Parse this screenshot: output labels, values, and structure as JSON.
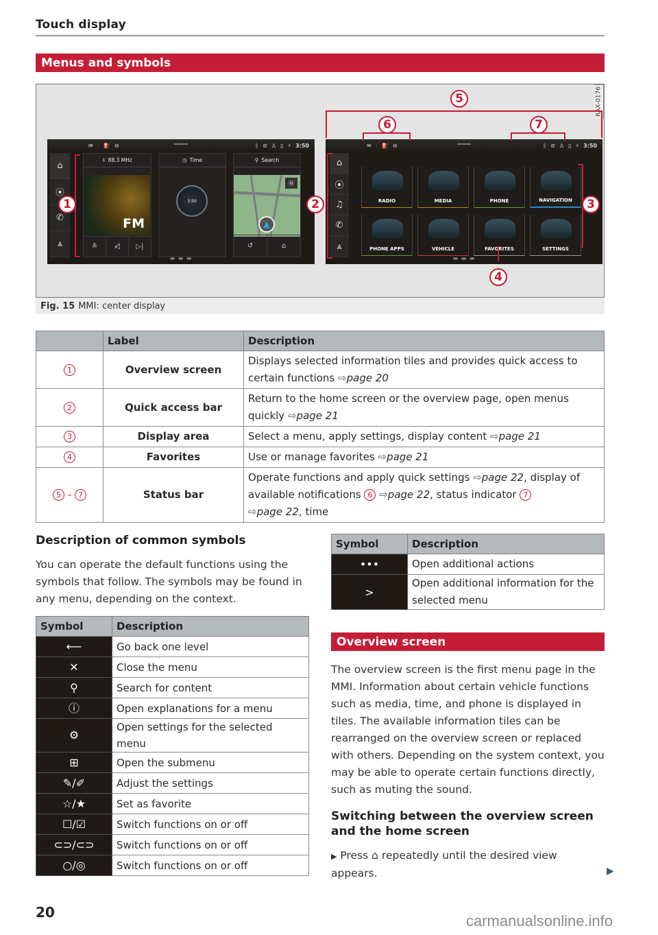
{
  "header": {
    "title": "Touch display"
  },
  "section_title": "Menus and symbols",
  "figure": {
    "id_code": "RAX-0176",
    "caption_label": "Fig. 15",
    "caption_text": "MMI: center display",
    "left_screen": {
      "status_time": "3:50",
      "tiles": [
        {
          "header": "88.3 MHz",
          "icon": "radio-antenna-icon",
          "art_text": "FM",
          "controls": [
            "≙",
            "🔇",
            "⏭"
          ]
        },
        {
          "header": "Time",
          "icon": "clock-icon",
          "clock_text": "3:50"
        },
        {
          "header": "Search",
          "icon": "search-icon",
          "controls": [
            "history",
            "home"
          ]
        }
      ],
      "quick_access": [
        "home",
        "radio",
        "phone",
        "navigation"
      ]
    },
    "right_screen": {
      "status_time": "3:50",
      "menu_tiles": [
        "RADIO",
        "MEDIA",
        "PHONE",
        "NAVIGATION",
        "PHONE APPS",
        "VEHICLE",
        "FAVORITES",
        "SETTINGS"
      ],
      "quick_access": [
        "home",
        "radio",
        "media",
        "phone",
        "navigation"
      ]
    },
    "callouts": [
      "1",
      "2",
      "3",
      "4",
      "5",
      "6",
      "7"
    ]
  },
  "label_table": {
    "headers": [
      "",
      "Label",
      "Description"
    ],
    "rows": [
      {
        "num": "1",
        "label": "Overview screen",
        "desc": "Displays selected information tiles and provides quick access to certain functions",
        "ref": "page 20"
      },
      {
        "num": "2",
        "label": "Quick access bar",
        "desc": "Return to the home screen or the overview page, open menus quickly",
        "ref": "page 21"
      },
      {
        "num": "3",
        "label": "Display area",
        "desc": "Select a menu, apply settings, display content",
        "ref": "page 21"
      },
      {
        "num": "4",
        "label": "Favorites",
        "desc": "Use or manage favorites",
        "ref": "page 21"
      },
      {
        "num": "5",
        "num_end": "7",
        "label": "Status bar",
        "desc_a": "Operate functions and apply quick settings",
        "ref_a": "page 22",
        "desc_b": ", display of available notifications",
        "circ_b": "6",
        "ref_b": "page 22",
        "desc_c": ", status indicator",
        "circ_c": "7",
        "ref_c": "page 22",
        "desc_d": ", time"
      }
    ]
  },
  "common_symbols": {
    "heading": "Description of common symbols",
    "intro": "You can operate the default functions using the symbols that follow. The symbols may be found in any menu, depending on the context.",
    "headers": [
      "Symbol",
      "Description"
    ],
    "rows": [
      {
        "symbol": "⟵",
        "icon": "back-icon",
        "desc": "Go back one level"
      },
      {
        "symbol": "✕",
        "icon": "close-icon",
        "desc": "Close the menu"
      },
      {
        "symbol": "⚲",
        "icon": "search-icon",
        "desc": "Search for content"
      },
      {
        "symbol": "ⓘ",
        "icon": "info-icon",
        "desc": "Open explanations for a menu"
      },
      {
        "symbol": "⚙",
        "icon": "gear-icon",
        "desc": "Open settings for the selected menu"
      },
      {
        "symbol": "⊞",
        "icon": "submenu-icon",
        "desc": "Open the submenu"
      },
      {
        "symbol": "✎/✐",
        "icon": "edit-icon",
        "desc": "Adjust the settings"
      },
      {
        "symbol": "☆/★",
        "icon": "star-icon",
        "desc": "Set as favorite"
      },
      {
        "symbol": "☐/☑",
        "icon": "checkbox-icon",
        "desc": "Switch functions on or off"
      },
      {
        "symbol": "⊂⊃/⊂⊃",
        "icon": "toggle-icon",
        "desc": "Switch functions on or off"
      },
      {
        "symbol": "○/◎",
        "icon": "radio-button-icon",
        "desc": "Switch functions on or off"
      }
    ]
  },
  "actions_table": {
    "headers": [
      "Symbol",
      "Description"
    ],
    "rows": [
      {
        "symbol": "•••",
        "icon": "more-icon",
        "desc": "Open additional actions"
      },
      {
        "symbol": ">",
        "icon": "chevron-right-icon",
        "desc": "Open additional information for the selected menu"
      }
    ]
  },
  "overview": {
    "title": "Overview screen",
    "body": "The overview screen is the first menu page in the MMI. Information about certain vehicle functions such as media, time, and phone is displayed in tiles. The available information tiles can be rearranged on the overview screen or replaced with others. Depending on the system context, you may be able to operate certain functions directly, such as muting the sound.",
    "sub_heading": "Switching between the overview screen and the home screen",
    "step_pre": "Press",
    "step_post": "repeatedly until the desired view appears."
  },
  "footer": {
    "page_number": "20",
    "watermark": "carmanualsonline.info"
  },
  "colors": {
    "accent_red": "#c41d35",
    "table_header": "#b4b9bc",
    "symbol_cell": "#1f1a16"
  }
}
